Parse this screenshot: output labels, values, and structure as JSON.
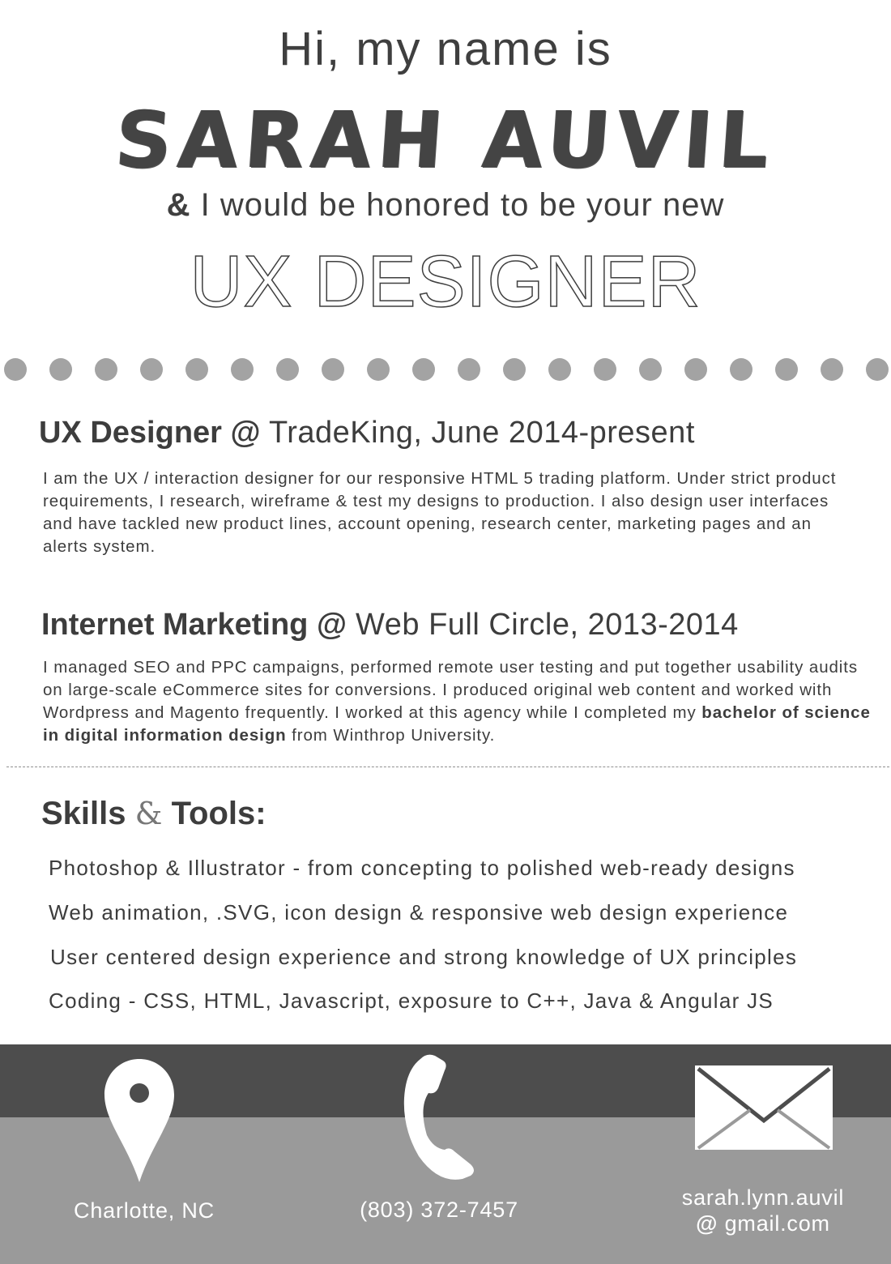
{
  "header": {
    "greeting": "Hi, my name is",
    "name": "SARAH AUVIL",
    "tagline_amp": "&",
    "tagline_rest": " I would be honored to be your new",
    "role": "UX DESIGNER"
  },
  "experience": [
    {
      "title_bold": "UX Designer @",
      "title_rest": " TradeKing, June 2014-present",
      "description": "I am the UX / interaction designer for our responsive HTML 5 trading platform. Under strict product requirements, I research, wireframe & test my designs to production. I also design user interfaces and have tackled new product lines, account opening, research center, marketing pages and an alerts system."
    },
    {
      "title_bold": "Internet Marketing @",
      "title_rest": " Web Full Circle, 2013-2014",
      "description_start": "I managed SEO and PPC campaigns, performed remote user testing and put together usability audits on large-scale eCommerce sites for conversions. I produced original web content and worked with Wordpress and Magento frequently. I worked at this agency while I completed my ",
      "description_bold": "bachelor of science in digital information design",
      "description_end": " from Winthrop University."
    }
  ],
  "skills": {
    "heading_part1": "Skills ",
    "heading_amp": "&",
    "heading_part2": " Tools:",
    "items": [
      "Photoshop & Illustrator - from concepting to polished web-ready designs",
      "Web animation, .SVG, icon design & responsive web design experience",
      "User centered design experience and strong knowledge of UX principles",
      "Coding - CSS, HTML, Javascript, exposure to C++, Java & Angular JS"
    ]
  },
  "contact": {
    "location": "Charlotte, NC",
    "phone": "(803) 372-7457",
    "email_line1": "sarah.lynn.auvil",
    "email_at": "@",
    "email_line2": " gmail.com",
    "location_icon": "map-pin-icon",
    "phone_icon": "phone-handset-icon",
    "email_icon": "envelope-icon"
  },
  "colors": {
    "text": "#3d3d3d",
    "dots": "#a3a3a3",
    "footer_dark": "#4d4d4d",
    "footer_light": "#9a9a9a",
    "footer_text": "#ffffff"
  }
}
